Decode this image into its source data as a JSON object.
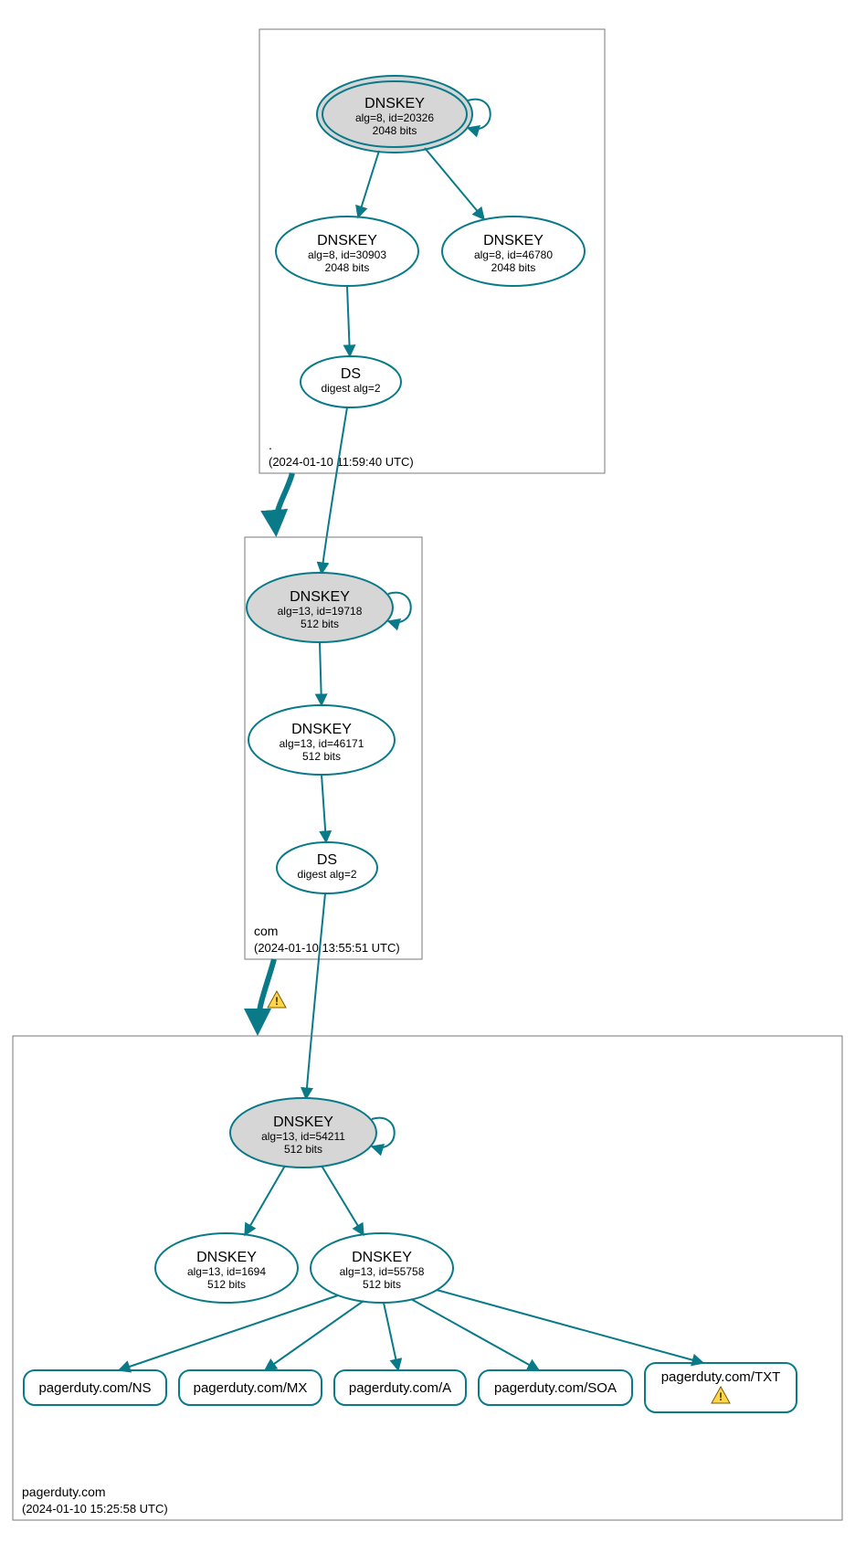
{
  "colors": {
    "stroke": "#0a7a89",
    "fill_grey": "#d6d6d6",
    "fill_white": "#ffffff",
    "box": "#7a7a7a",
    "text": "#000000"
  },
  "zones": {
    "root": {
      "label": ".",
      "timestamp": "(2024-01-10 11:59:40 UTC)",
      "nodes": {
        "ksk": {
          "title": "DNSKEY",
          "line2": "alg=8, id=20326",
          "line3": "2048 bits"
        },
        "zsk1": {
          "title": "DNSKEY",
          "line2": "alg=8, id=30903",
          "line3": "2048 bits"
        },
        "zsk2": {
          "title": "DNSKEY",
          "line2": "alg=8, id=46780",
          "line3": "2048 bits"
        },
        "ds": {
          "title": "DS",
          "line2": "digest alg=2"
        }
      }
    },
    "com": {
      "label": "com",
      "timestamp": "(2024-01-10 13:55:51 UTC)",
      "nodes": {
        "ksk": {
          "title": "DNSKEY",
          "line2": "alg=13, id=19718",
          "line3": "512 bits"
        },
        "zsk": {
          "title": "DNSKEY",
          "line2": "alg=13, id=46171",
          "line3": "512 bits"
        },
        "ds": {
          "title": "DS",
          "line2": "digest alg=2"
        }
      }
    },
    "pagerduty": {
      "label": "pagerduty.com",
      "timestamp": "(2024-01-10 15:25:58 UTC)",
      "nodes": {
        "ksk": {
          "title": "DNSKEY",
          "line2": "alg=13, id=54211",
          "line3": "512 bits"
        },
        "zsk1": {
          "title": "DNSKEY",
          "line2": "alg=13, id=1694",
          "line3": "512 bits"
        },
        "zsk2": {
          "title": "DNSKEY",
          "line2": "alg=13, id=55758",
          "line3": "512 bits"
        }
      },
      "records": {
        "ns": "pagerduty.com/NS",
        "mx": "pagerduty.com/MX",
        "a": "pagerduty.com/A",
        "soa": "pagerduty.com/SOA",
        "txt": "pagerduty.com/TXT"
      }
    }
  },
  "warnings": {
    "edge_com_to_pd": true,
    "txt_record": true
  }
}
